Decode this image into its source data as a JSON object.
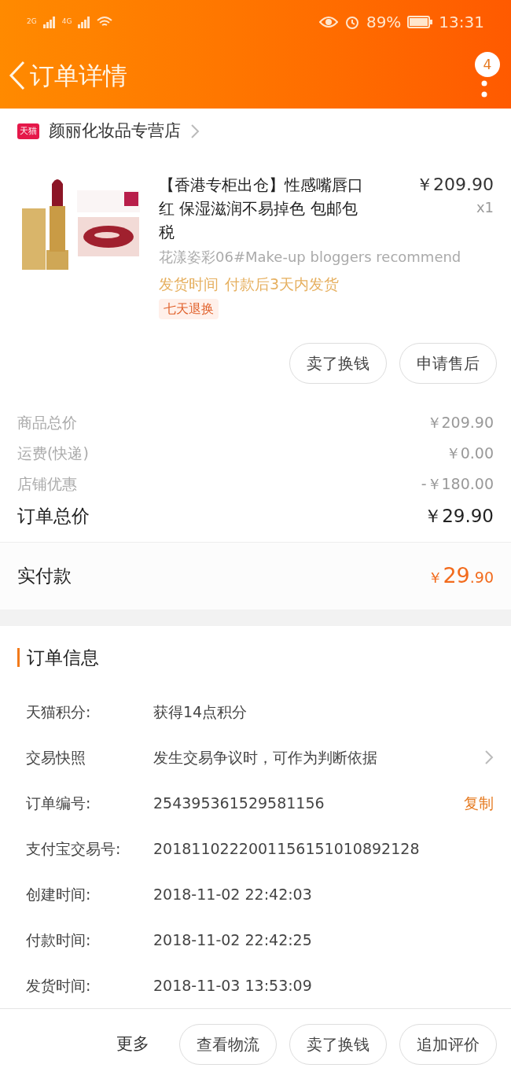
{
  "status_bar": {
    "network_1": "2G",
    "network_2": "4G",
    "battery": "89%",
    "time": "13:31"
  },
  "header": {
    "title": "订单详情",
    "badge": "4"
  },
  "shop": {
    "platform_label": "天猫",
    "name": "颜丽化妆品专营店"
  },
  "product": {
    "image": {
      "kind": "picture"
    },
    "title": "【香港专柜出仓】性感嘴唇口红 保湿滋润不易掉色 包邮包税",
    "price": "￥209.90",
    "quantity": "x1",
    "variant": "花漾姿彩06#Make-up bloggers recommend",
    "shipping_label": "发货时间",
    "shipping_value": "付款后3天内发货",
    "tag": "七天退换",
    "actions": [
      "卖了换钱",
      "申请售后"
    ]
  },
  "summary": [
    {
      "label": "商品总价",
      "value": "￥209.90",
      "kind": "line"
    },
    {
      "label": "运费(快递)",
      "value": "￥0.00",
      "kind": "line"
    },
    {
      "label": "店铺优惠",
      "value": "-￥180.00",
      "kind": "line"
    },
    {
      "label": "订单总价",
      "value": "￥29.90",
      "kind": "total"
    }
  ],
  "paid": {
    "label": "实付款",
    "currency": "￥",
    "integer": "29",
    "decimal": ".90"
  },
  "order_info": {
    "title": "订单信息",
    "rows": [
      {
        "label": "天猫积分:",
        "value": "获得14点积分",
        "kind": "plain"
      },
      {
        "label": "交易快照",
        "value": "发生交易争议时，可作为判断依据",
        "kind": "link"
      },
      {
        "label": "订单编号:",
        "value": "254395361529581156",
        "kind": "copy",
        "action": "复制"
      },
      {
        "label": "支付宝交易号:",
        "value": "2018110222001156151010892128",
        "kind": "plain"
      },
      {
        "label": "创建时间:",
        "value": "2018-11-02 22:42:03",
        "kind": "plain"
      },
      {
        "label": "付款时间:",
        "value": "2018-11-02 22:42:25",
        "kind": "plain"
      },
      {
        "label": "发货时间:",
        "value": "2018-11-03 13:53:09",
        "kind": "plain"
      }
    ]
  },
  "bottom_bar": {
    "more": "更多",
    "buttons": [
      "查看物流",
      "卖了换钱",
      "追加评价"
    ]
  }
}
